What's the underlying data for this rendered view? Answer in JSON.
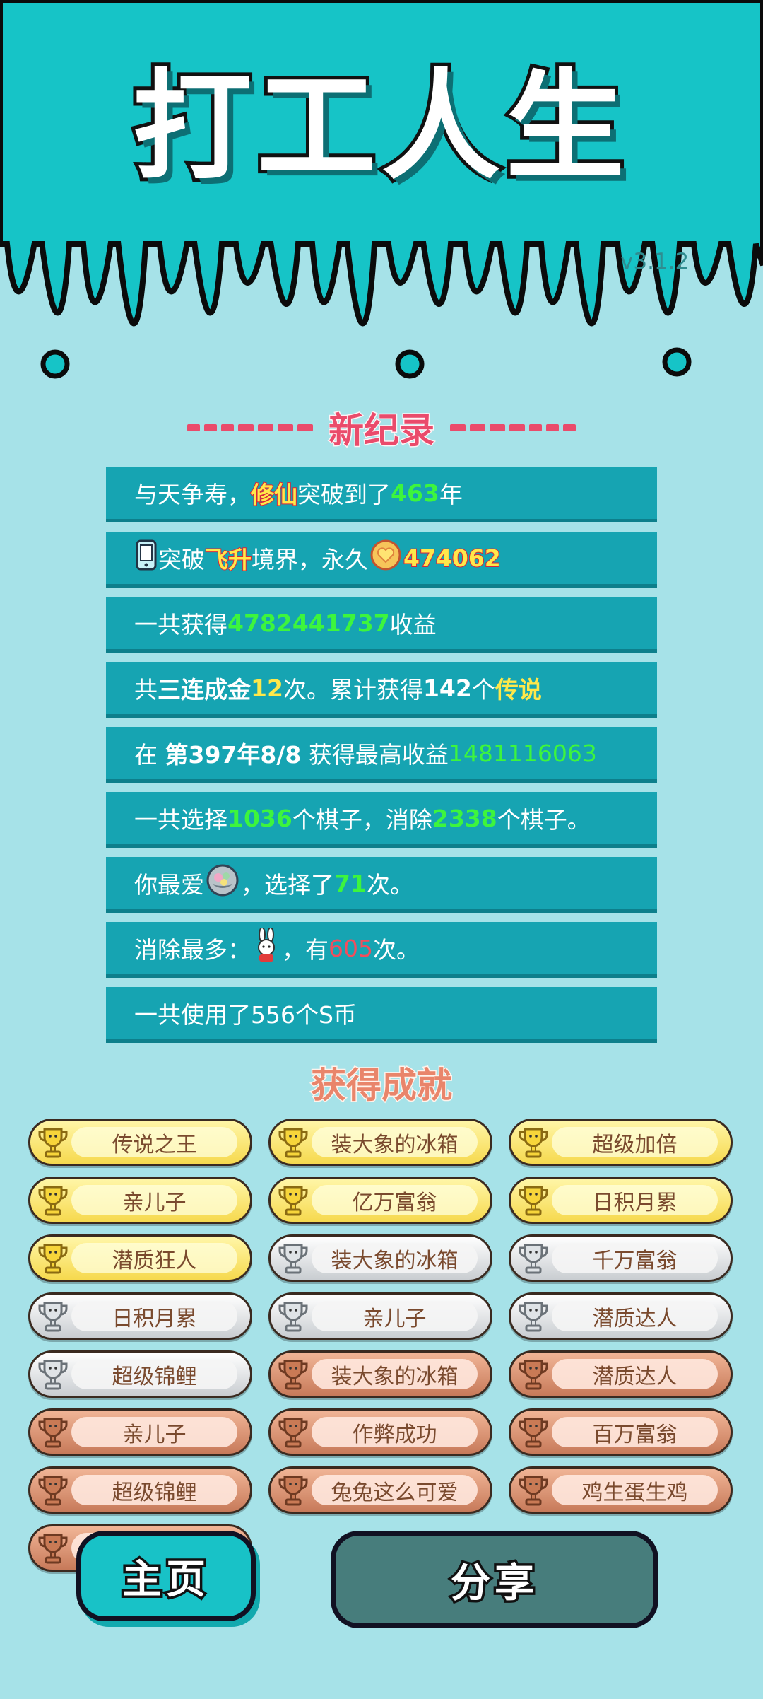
{
  "header": {
    "title": "打工人生",
    "version": "v3.1.2"
  },
  "record": {
    "title": "新纪录",
    "rows": [
      {
        "t1": "与天争寿，",
        "hl": "修仙",
        "t2": "突破到了",
        "num": "463",
        "t3": "年"
      },
      {
        "t1": "突破",
        "hl": "飞升",
        "t2": "境界，永久",
        "num": "474062"
      },
      {
        "t1": "一共获得",
        "num": "4782441737",
        "t2": "收益"
      },
      {
        "t1": "共",
        "b1": "三连成金",
        "n1": "12",
        "t2": "次。累计获得",
        "b2": "142",
        "t3": "个",
        "hl": "传说"
      },
      {
        "t1": "在 ",
        "b1": "第397年8/8",
        "t2": " 获得最高收益",
        "num": "1481116063"
      },
      {
        "t1": "一共选择",
        "n1": "1036",
        "t2": "个棋子，消除",
        "n2": "2338",
        "t3": "个棋子。"
      },
      {
        "t1": "你最爱",
        "t2": "，选择了",
        "num": "71",
        "t3": "次。"
      },
      {
        "t1": "消除最多：",
        "t2": "，有",
        "num": "605",
        "t3": "次。"
      },
      {
        "t1": "一共使用了556个S币"
      }
    ]
  },
  "achievements": {
    "title": "获得成就",
    "items": [
      {
        "label": "传说之王",
        "tier": "gold"
      },
      {
        "label": "装大象的冰箱",
        "tier": "gold"
      },
      {
        "label": "超级加倍",
        "tier": "gold"
      },
      {
        "label": "亲儿子",
        "tier": "gold"
      },
      {
        "label": "亿万富翁",
        "tier": "gold"
      },
      {
        "label": "日积月累",
        "tier": "gold"
      },
      {
        "label": "潜质狂人",
        "tier": "gold"
      },
      {
        "label": "装大象的冰箱",
        "tier": "silver"
      },
      {
        "label": "千万富翁",
        "tier": "silver"
      },
      {
        "label": "日积月累",
        "tier": "silver"
      },
      {
        "label": "亲儿子",
        "tier": "silver"
      },
      {
        "label": "潜质达人",
        "tier": "silver"
      },
      {
        "label": "超级锦鲤",
        "tier": "silver"
      },
      {
        "label": "装大象的冰箱",
        "tier": "bronze"
      },
      {
        "label": "潜质达人",
        "tier": "bronze"
      },
      {
        "label": "亲儿子",
        "tier": "bronze"
      },
      {
        "label": "作弊成功",
        "tier": "bronze"
      },
      {
        "label": "百万富翁",
        "tier": "bronze"
      },
      {
        "label": "超级锦鲤",
        "tier": "bronze"
      },
      {
        "label": "兔兔这么可爱",
        "tier": "bronze"
      },
      {
        "label": "鸡生蛋生鸡",
        "tier": "bronze"
      },
      {
        "label": "",
        "tier": "bronze"
      }
    ]
  },
  "nav": {
    "home_label": "主页",
    "share_label": "分享"
  },
  "colors": {
    "header_bg": "#16c4c7",
    "page_bg": "#a6e2e8",
    "row_bg": "#16a4b2",
    "record_red": "#ea4b6b",
    "value_green": "#3df53d",
    "value_yellow": "#ffe84a",
    "value_red": "#f24d5c"
  },
  "icons": {
    "phone": "phone-icon",
    "coin": "heart-coin-icon",
    "favorite": "cart-item-icon",
    "most_removed": "rabbit-icon",
    "trophy": "trophy-icon"
  }
}
